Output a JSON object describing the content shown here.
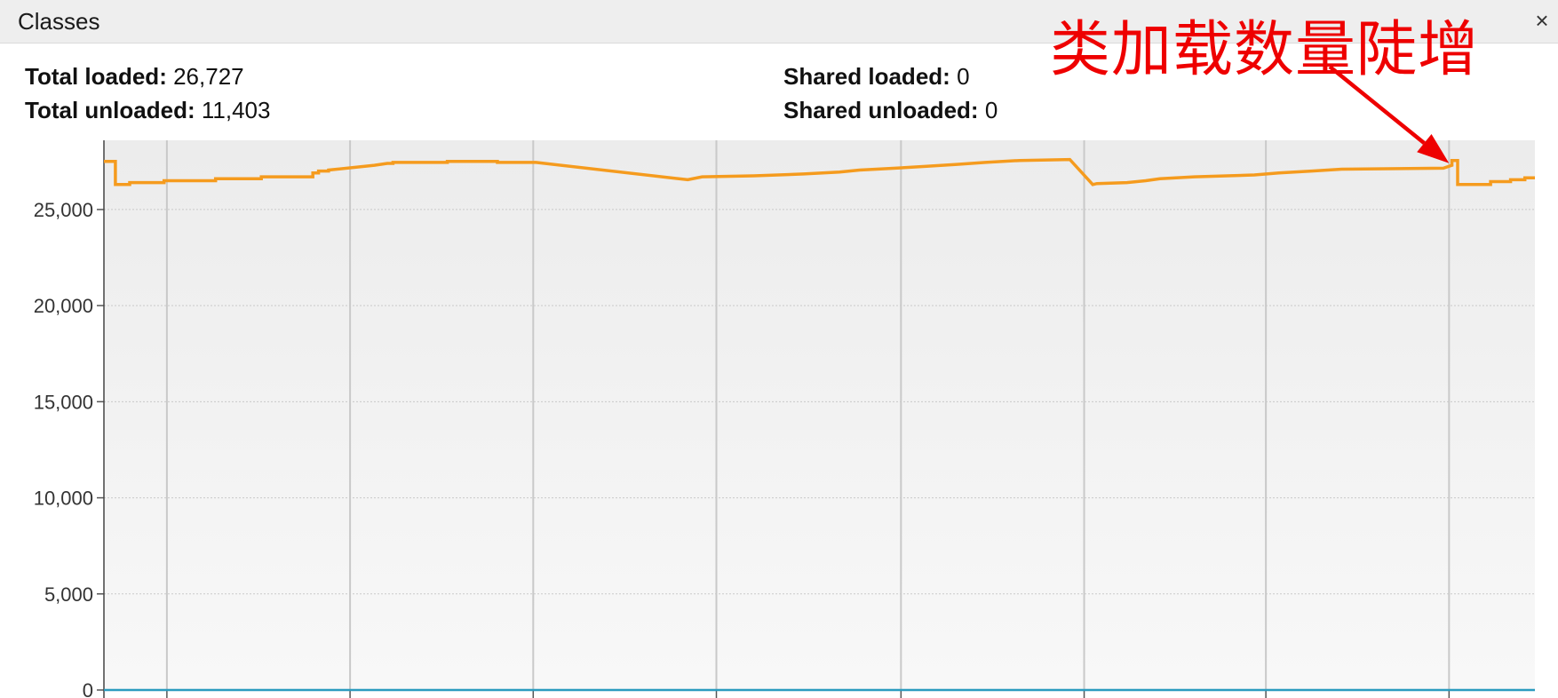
{
  "window": {
    "title": "Classes",
    "close_label": "×"
  },
  "stats": {
    "total_loaded_label": "Total loaded:",
    "total_loaded_value": "26,727",
    "total_unloaded_label": "Total unloaded:",
    "total_unloaded_value": "11,403",
    "shared_loaded_label": "Shared loaded:",
    "shared_loaded_value": "0",
    "shared_unloaded_label": "Shared unloaded:",
    "shared_unloaded_value": "0"
  },
  "annotation": {
    "text": "类加载数量陡增",
    "color": "#ee0000"
  },
  "colors": {
    "loaded_line": "#f59b1e",
    "shared_line": "#2b9bbf",
    "plot_bg": "#f2f2f2"
  },
  "chart_data": {
    "type": "line",
    "title": "",
    "xlabel": "",
    "ylabel": "",
    "ylim": [
      0,
      28600
    ],
    "yticks": [
      0,
      5000,
      10000,
      15000,
      20000,
      25000
    ],
    "ytick_labels": [
      "0",
      "5,000",
      "10,000",
      "15,000",
      "20,000",
      "25,000"
    ],
    "xlim": [
      0,
      100
    ],
    "x_gridlines": [
      4.4,
      17.2,
      30,
      42.8,
      55.7,
      68.5,
      81.2,
      94
    ],
    "grid": true,
    "series": [
      {
        "color": "#f59b1e",
        "x": [
          0,
          0.8,
          0.8,
          1.8,
          1.8,
          4.2,
          4.2,
          7.8,
          7.8,
          11,
          11,
          14.6,
          14.6,
          15,
          15,
          15.7,
          15.7,
          18.9,
          19.8,
          20.2,
          20.2,
          24,
          24,
          27.5,
          27.5,
          30,
          30.2,
          40.8,
          40.8,
          41.8,
          41.8,
          45.4,
          45.4,
          48.9,
          48.9,
          51.4,
          51.4,
          52.8,
          52.8,
          55.3,
          55.3,
          57.5,
          57.5,
          59.6,
          59.6,
          61.6,
          61.6,
          64,
          64,
          67.5,
          67.5,
          69.1,
          69.1,
          69.4,
          69.4,
          71.5,
          71.5,
          72.8,
          72.8,
          73.8,
          73.8,
          76.2,
          76.2,
          80.4,
          80.4,
          82.1,
          82.1,
          84.4,
          84.4,
          86.5,
          86.5,
          93.6,
          94.2,
          94.2,
          94.6,
          94.6,
          96.9,
          96.9,
          98.3,
          98.3,
          99.3,
          99.3,
          100
        ],
        "y": [
          27500,
          27500,
          26300,
          26300,
          26400,
          26400,
          26500,
          26500,
          26600,
          26600,
          26700,
          26700,
          26900,
          26900,
          27000,
          27000,
          27050,
          27300,
          27400,
          27400,
          27450,
          27450,
          27500,
          27500,
          27450,
          27450,
          27450,
          26550,
          26550,
          26700,
          26700,
          26750,
          26750,
          26850,
          26850,
          26950,
          26950,
          27050,
          27050,
          27150,
          27150,
          27250,
          27250,
          27350,
          27350,
          27450,
          27450,
          27550,
          27550,
          27600,
          27600,
          26300,
          26300,
          26350,
          26350,
          26400,
          26400,
          26500,
          26500,
          26600,
          26600,
          26700,
          26700,
          26800,
          26800,
          26900,
          26900,
          27000,
          27000,
          27100,
          27100,
          27150,
          27300,
          27550,
          27550,
          26300,
          26300,
          26450,
          26450,
          26550,
          26550,
          26650,
          26650
        ]
      },
      {
        "color": "#2b9bbf",
        "x": [
          0,
          100
        ],
        "y": [
          0,
          0
        ]
      }
    ]
  }
}
